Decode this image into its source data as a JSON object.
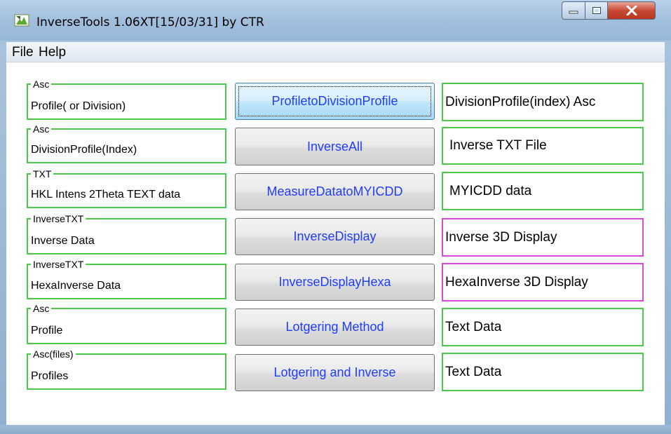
{
  "window": {
    "title": "InverseTools 1.06XT[15/03/31] by CTR",
    "icon": "app-icon",
    "controls": {
      "minimize": "minimize-icon",
      "maximize": "maximize-icon",
      "close": "close-icon"
    }
  },
  "menu": {
    "items": [
      "File",
      "Help"
    ]
  },
  "rows": [
    {
      "legend": "Asc",
      "input": "Profile( or Division)",
      "button": "ProfiletoDivisionProfile",
      "output": "DivisionProfile(index) Asc",
      "output_color": "green"
    },
    {
      "legend": "Asc",
      "input": "DivisionProfile(Index)",
      "button": "InverseAll",
      "output": "Inverse TXT File",
      "output_color": "green"
    },
    {
      "legend": "TXT",
      "input": "HKL Intens 2Theta TEXT data",
      "button": "MeasureDatatoMYICDD",
      "output": "MYICDD data",
      "output_color": "green"
    },
    {
      "legend": "InverseTXT",
      "input": "Inverse Data",
      "button": "InverseDisplay",
      "output": "Inverse 3D Display",
      "output_color": "magenta"
    },
    {
      "legend": "InverseTXT",
      "input": "HexaInverse Data",
      "button": "InverseDisplayHexa",
      "output": "HexaInverse 3D Display",
      "output_color": "magenta"
    },
    {
      "legend": "Asc",
      "input": "Profile",
      "button": "Lotgering Method",
      "output": "Text Data",
      "output_color": "green"
    },
    {
      "legend": "Asc(files)",
      "input": "Profiles",
      "button": "Lotgering and Inverse",
      "output": "Text Data",
      "output_color": "green"
    }
  ],
  "colors": {
    "group_border": "#4cc84c",
    "display_border": "#d84bd8",
    "button_text": "#1f3cff",
    "titlebar": "#a1bfdd"
  }
}
